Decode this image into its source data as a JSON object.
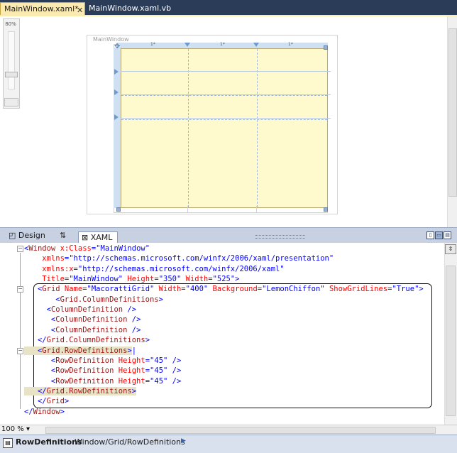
{
  "tabs": {
    "active": "MainWindow.xaml*",
    "close_glyph": "✕",
    "second": "MainWindow.xaml.vb"
  },
  "designer": {
    "zoom_label": "80%",
    "window_title": "MainWindow",
    "column_labels": [
      "1*",
      "1*",
      "1*"
    ],
    "move_glyph": "✥"
  },
  "view_bar": {
    "design_label": "Design",
    "swap_label": "⇅",
    "xaml_label": "XAML",
    "pane_buttons": [
      "▯",
      "▭",
      "▤"
    ]
  },
  "code": {
    "lines": [
      {
        "fold": "−",
        "parts": [
          {
            "c": "blue",
            "t": "<"
          },
          {
            "c": "tag",
            "t": "Window"
          },
          {
            "c": "attr",
            "t": " x:Class"
          },
          {
            "c": "blue",
            "t": "="
          },
          {
            "c": "val",
            "t": "\"MainWindow\""
          }
        ]
      },
      {
        "fold": "",
        "parts": [
          {
            "c": "attr",
            "t": "    xmlns"
          },
          {
            "c": "blue",
            "t": "="
          },
          {
            "c": "val",
            "t": "\"http://schemas.microsoft.com/winfx/2006/xaml/presentation\""
          }
        ]
      },
      {
        "fold": "",
        "parts": [
          {
            "c": "attr",
            "t": "    xmlns:x"
          },
          {
            "c": "blue",
            "t": "="
          },
          {
            "c": "val",
            "t": "\"http://schemas.microsoft.com/winfx/2006/xaml\""
          }
        ]
      },
      {
        "fold": "",
        "parts": [
          {
            "c": "attr",
            "t": "    Title"
          },
          {
            "c": "blue",
            "t": "="
          },
          {
            "c": "val",
            "t": "\"MainWindow\""
          },
          {
            "c": "attr",
            "t": " Height"
          },
          {
            "c": "blue",
            "t": "="
          },
          {
            "c": "val",
            "t": "\"350\""
          },
          {
            "c": "attr",
            "t": " Width"
          },
          {
            "c": "blue",
            "t": "="
          },
          {
            "c": "val",
            "t": "\"525\""
          },
          {
            "c": "blue",
            "t": ">"
          }
        ]
      },
      {
        "fold": "−",
        "parts": [
          {
            "c": "blue",
            "t": "   <"
          },
          {
            "c": "tag",
            "t": "Grid"
          },
          {
            "c": "attr",
            "t": " Name"
          },
          {
            "c": "blue",
            "t": "="
          },
          {
            "c": "val",
            "t": "\"MacorattiGrid\""
          },
          {
            "c": "attr",
            "t": " Width"
          },
          {
            "c": "blue",
            "t": "="
          },
          {
            "c": "val",
            "t": "\"400\""
          },
          {
            "c": "attr",
            "t": " Background"
          },
          {
            "c": "blue",
            "t": "="
          },
          {
            "c": "val",
            "t": "\"LemonChiffon\""
          },
          {
            "c": "attr",
            "t": " ShowGridLines"
          },
          {
            "c": "blue",
            "t": "="
          },
          {
            "c": "val",
            "t": "\"True\""
          },
          {
            "c": "blue",
            "t": ">"
          }
        ]
      },
      {
        "fold": "",
        "parts": [
          {
            "c": "blue",
            "t": "       <"
          },
          {
            "c": "tag",
            "t": "Grid.ColumnDefinitions"
          },
          {
            "c": "blue",
            "t": ">"
          }
        ]
      },
      {
        "fold": "",
        "parts": [
          {
            "c": "blue",
            "t": "     <"
          },
          {
            "c": "tag",
            "t": "ColumnDefinition"
          },
          {
            "c": "blue",
            "t": " />"
          }
        ]
      },
      {
        "fold": "",
        "parts": [
          {
            "c": "blue",
            "t": "      <"
          },
          {
            "c": "tag",
            "t": "ColumnDefinition"
          },
          {
            "c": "blue",
            "t": " />"
          }
        ]
      },
      {
        "fold": "",
        "parts": [
          {
            "c": "blue",
            "t": "      <"
          },
          {
            "c": "tag",
            "t": "ColumnDefinition"
          },
          {
            "c": "blue",
            "t": " />"
          }
        ]
      },
      {
        "fold": "",
        "parts": [
          {
            "c": "blue",
            "t": "   </"
          },
          {
            "c": "tag",
            "t": "Grid.ColumnDefinitions"
          },
          {
            "c": "blue",
            "t": ">"
          }
        ]
      },
      {
        "fold": "−",
        "parts": [
          {
            "c": "blue hl",
            "t": "   <"
          },
          {
            "c": "tag hl",
            "t": "Grid.RowDefinitions"
          },
          {
            "c": "blue hl",
            "t": ">"
          },
          {
            "c": "blue",
            "t": "|"
          }
        ]
      },
      {
        "fold": "",
        "parts": [
          {
            "c": "blue",
            "t": "      <"
          },
          {
            "c": "tag",
            "t": "RowDefinition"
          },
          {
            "c": "attr",
            "t": " Height"
          },
          {
            "c": "blue",
            "t": "="
          },
          {
            "c": "val",
            "t": "\"45\""
          },
          {
            "c": "blue",
            "t": " />"
          }
        ]
      },
      {
        "fold": "",
        "parts": [
          {
            "c": "blue",
            "t": "      <"
          },
          {
            "c": "tag",
            "t": "RowDefinition"
          },
          {
            "c": "attr",
            "t": " Height"
          },
          {
            "c": "blue",
            "t": "="
          },
          {
            "c": "val",
            "t": "\"45\""
          },
          {
            "c": "blue",
            "t": " />"
          }
        ]
      },
      {
        "fold": "",
        "parts": [
          {
            "c": "blue",
            "t": "      <"
          },
          {
            "c": "tag",
            "t": "RowDefinition"
          },
          {
            "c": "attr",
            "t": " Height"
          },
          {
            "c": "blue",
            "t": "="
          },
          {
            "c": "val",
            "t": "\"45\""
          },
          {
            "c": "blue",
            "t": " />"
          }
        ]
      },
      {
        "fold": "",
        "parts": [
          {
            "c": "blue hl",
            "t": "   </"
          },
          {
            "c": "tag hl",
            "t": "Grid.RowDefinitions"
          },
          {
            "c": "blue hl",
            "t": ">"
          }
        ]
      },
      {
        "fold": "",
        "parts": [
          {
            "c": "blue",
            "t": "   </"
          },
          {
            "c": "tag",
            "t": "Grid"
          },
          {
            "c": "blue",
            "t": ">"
          }
        ]
      },
      {
        "fold": "",
        "parts": [
          {
            "c": "blue",
            "t": "</"
          },
          {
            "c": "tag",
            "t": "Window"
          },
          {
            "c": "blue",
            "t": ">"
          }
        ]
      }
    ]
  },
  "editor": {
    "zoom_value": "100 %",
    "split_glyph": "⇕"
  },
  "status": {
    "icon_glyph": "▤",
    "bold": "RowDefinitions",
    "path": "Window/Grid/RowDefinitions",
    "arrow": "▶"
  },
  "colors": {
    "grid_background": "#fffacd",
    "active_tab": "#fcebb0",
    "tab_strip": "#2b3c59"
  }
}
